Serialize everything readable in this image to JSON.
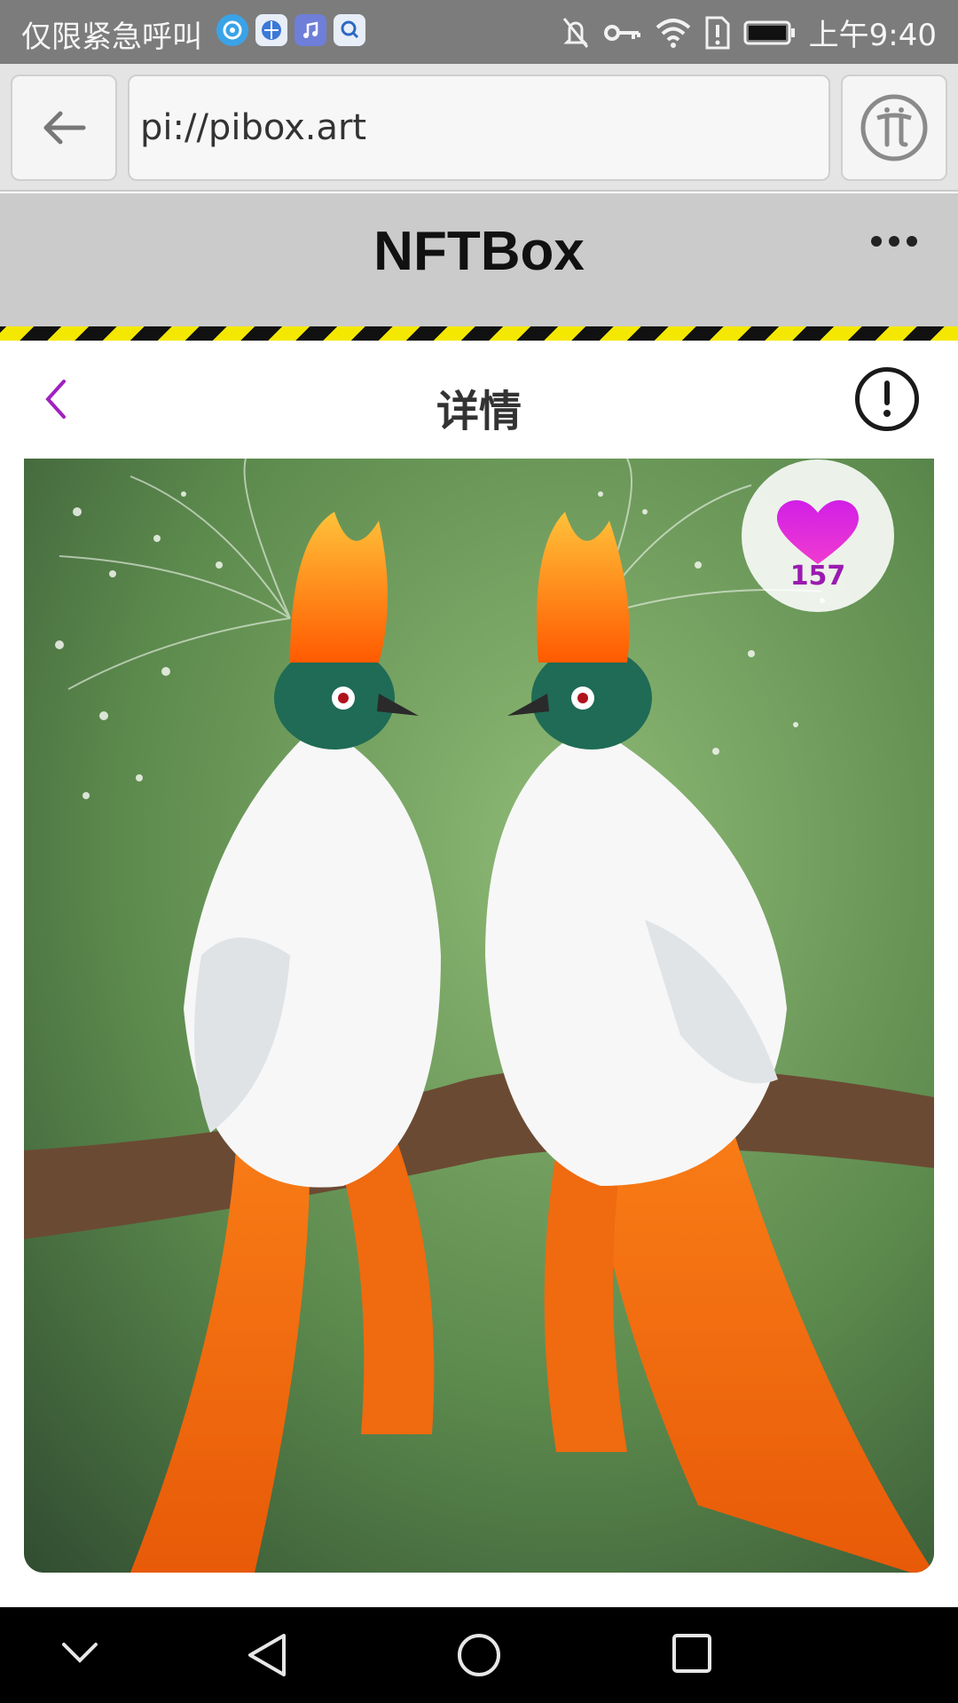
{
  "status_bar": {
    "carrier_text": "仅限紧急呼叫",
    "time": "上午9:40",
    "icons": [
      "weibo-icon",
      "browser-icon",
      "music-icon",
      "app-icon",
      "mute-icon",
      "key-icon",
      "wifi-icon",
      "alert-icon",
      "battery-icon"
    ]
  },
  "browser": {
    "url": "pi://pibox.art",
    "back_icon": "arrow-left-icon",
    "pi_icon": "pi-logo-icon"
  },
  "app_header": {
    "title": "NFTBox",
    "menu_icon": "more-dots-icon"
  },
  "page_header": {
    "title": "详情",
    "back_icon": "chevron-left-icon",
    "info_icon": "exclamation-circle-icon"
  },
  "artwork": {
    "subject": "two birds of paradise with orange crests and tails on a branch",
    "like_count": "157",
    "like_icon": "heart-icon"
  },
  "nav_bar": {
    "icons": [
      "collapse-icon",
      "back-triangle-icon",
      "home-circle-icon",
      "recents-square-icon"
    ]
  },
  "colors": {
    "accent": "#a020c0",
    "status_bar": "#7c7c7c",
    "header": "#cbcbcb",
    "hazard_yellow": "#f4e800"
  }
}
